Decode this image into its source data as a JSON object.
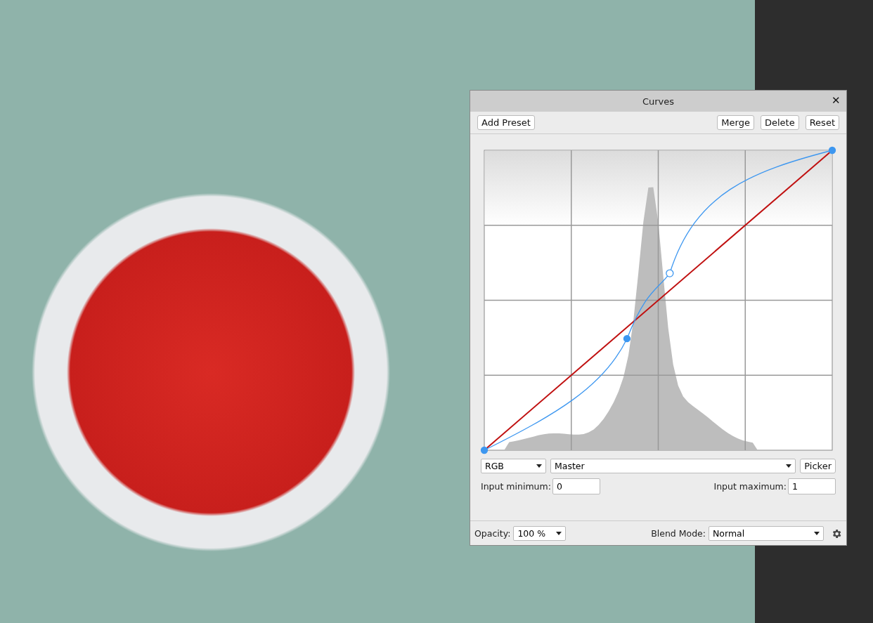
{
  "window": {
    "title": "Curves",
    "close": "✕"
  },
  "preset_buttons": [
    {
      "label": "Add Preset",
      "kind": "left"
    },
    {
      "label": "Merge",
      "kind": "right"
    },
    {
      "label": "Delete",
      "kind": "right"
    },
    {
      "label": "Reset",
      "kind": "right"
    }
  ],
  "channel_select": {
    "value": "RGB"
  },
  "channel_name_select": {
    "value": "Master"
  },
  "picker_button": {
    "label": "Picker"
  },
  "input_minimum": {
    "label": "Input minimum:",
    "value": "0"
  },
  "input_maximum": {
    "label": "Input maximum:",
    "value": "1"
  },
  "opacity": {
    "label": "Opacity:",
    "value": "100 %"
  },
  "blend_mode": {
    "label": "Blend Mode:",
    "value": "Normal"
  }
}
